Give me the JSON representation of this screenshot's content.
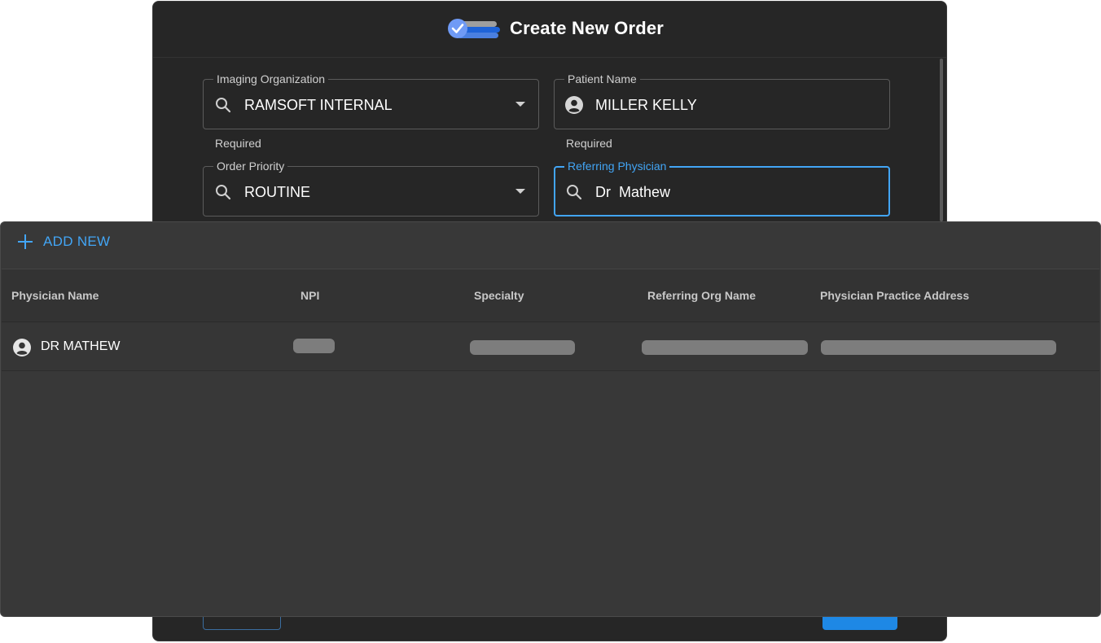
{
  "dialog": {
    "title": "Create New Order",
    "fields": {
      "imaging_org": {
        "label": "Imaging Organization",
        "value": "RAMSOFT INTERNAL",
        "helper": "Required",
        "icon": "search-icon"
      },
      "patient_name": {
        "label": "Patient Name",
        "value": "MILLER KELLY",
        "helper": "Required",
        "icon": "person-circle-icon"
      },
      "order_priority": {
        "label": "Order Priority",
        "value": "ROUTINE",
        "icon": "search-icon"
      },
      "referring_physician": {
        "label": "Referring Physician",
        "value": "Dr  Mathew",
        "icon": "search-icon"
      }
    }
  },
  "popup": {
    "add_new_label": "ADD NEW",
    "columns": [
      "Physician Name",
      "NPI",
      "Specialty",
      "Referring Org Name",
      "Physician Practice Address"
    ],
    "rows": [
      {
        "physician_name": "DR MATHEW",
        "npi": "",
        "specialty": "",
        "referring_org": "",
        "address": ""
      }
    ]
  },
  "colors": {
    "accent": "#42a5f5",
    "dialog_bg": "#262626",
    "popup_bg": "#383838"
  }
}
